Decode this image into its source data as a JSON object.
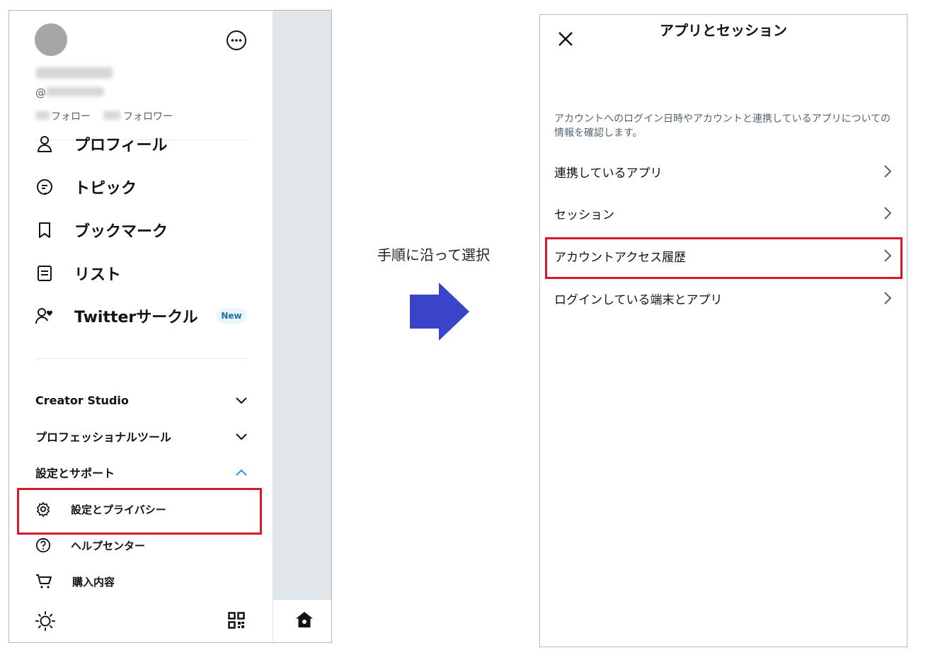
{
  "left": {
    "profile": {
      "handle_prefix": "@",
      "following_label": "フォロー",
      "followers_label": "フォロワー"
    },
    "menu": [
      {
        "label": "プロフィール",
        "icon": "profile-icon"
      },
      {
        "label": "トピック",
        "icon": "topic-icon"
      },
      {
        "label": "ブックマーク",
        "icon": "bookmark-icon"
      },
      {
        "label": "リスト",
        "icon": "list-icon"
      },
      {
        "label": "Twitterサークル",
        "icon": "twitter-circle-icon",
        "badge": "New"
      }
    ],
    "sections": [
      {
        "label": "Creator Studio",
        "expanded": false
      },
      {
        "label": "プロフェッショナルツール",
        "expanded": false
      },
      {
        "label": "設定とサポート",
        "expanded": true
      }
    ],
    "settings_items": [
      {
        "label": "設定とプライバシー",
        "icon": "gear-icon",
        "highlighted": true
      },
      {
        "label": "ヘルプセンター",
        "icon": "help-icon"
      },
      {
        "label": "購入内容",
        "icon": "cart-icon"
      }
    ]
  },
  "step_caption": "手順に沿って選択",
  "right": {
    "title": "アプリとセッション",
    "description": "アカウントへのログイン日時やアカウントと連携しているアプリについての情報を確認します。",
    "rows": [
      {
        "label": "連携しているアプリ"
      },
      {
        "label": "セッション"
      },
      {
        "label": "アカウントアクセス履歴",
        "highlighted": true
      },
      {
        "label": "ログインしている端末とアプリ"
      }
    ]
  },
  "colors": {
    "highlight": "#d51b2b",
    "arrow": "#3a44c9",
    "side_strip": "#e1e6ea",
    "accent_blue": "#1d9bf0"
  }
}
